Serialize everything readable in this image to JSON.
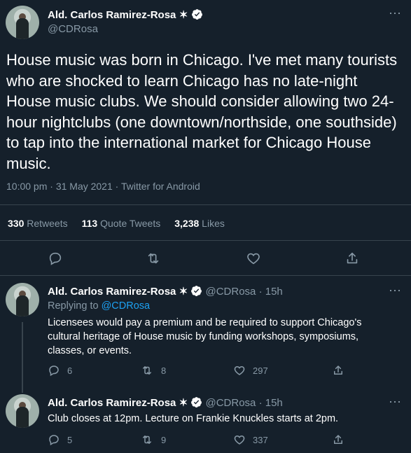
{
  "main_tweet": {
    "author_name": "Ald. Carlos Ramirez-Rosa",
    "author_star": "✶",
    "handle": "@CDRosa",
    "text": "House music was born in Chicago. I've met many tourists who are shocked to learn Chicago has no late-night House music clubs. We should consider allowing two 24-hour nightclubs (one downtown/northside, one southside) to tap into the international market for Chicago House music.",
    "time": "10:00 pm · 31 May 2021 · Twitter for Android",
    "stats": {
      "retweets_count": "330",
      "retweets_label": "Retweets",
      "quotes_count": "113",
      "quotes_label": "Quote Tweets",
      "likes_count": "3,238",
      "likes_label": "Likes"
    },
    "more_icon": "⋯"
  },
  "replies": [
    {
      "author_name": "Ald. Carlos Ramirez-Rosa",
      "author_star": "✶",
      "handle": "@CDRosa",
      "age": "· 15h",
      "replying_prefix": "Replying to",
      "replying_to": "@CDRosa",
      "text": "Licensees would pay a premium and be required to support Chicago's cultural heritage of House music by funding workshops, symposiums, classes, or events.",
      "reply_count": "6",
      "retweet_count": "8",
      "like_count": "297"
    },
    {
      "author_name": "Ald. Carlos Ramirez-Rosa",
      "author_star": "✶",
      "handle": "@CDRosa",
      "age": "· 15h",
      "text": "Club closes at 12pm. Lecture on Frankie Knuckles starts at 2pm.",
      "reply_count": "5",
      "retweet_count": "9",
      "like_count": "337"
    }
  ],
  "colors": {
    "background": "#15202b",
    "muted": "#8899a6",
    "accent": "#1da1f2",
    "divider": "#38444d"
  },
  "icons": [
    "verified-badge-icon",
    "more-icon",
    "reply-icon",
    "retweet-icon",
    "like-icon",
    "share-icon"
  ]
}
